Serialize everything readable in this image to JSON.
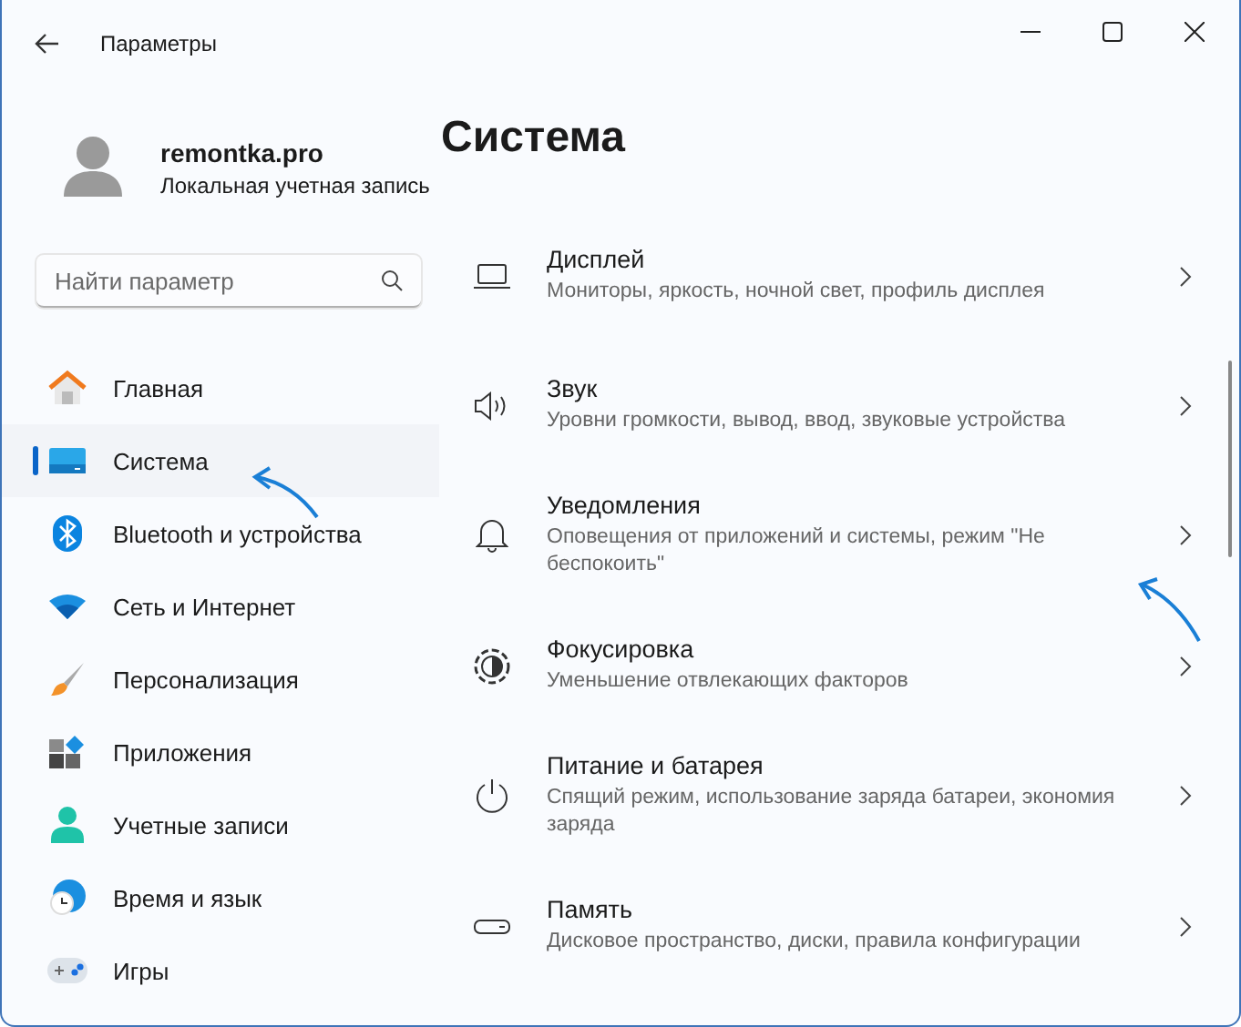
{
  "window": {
    "title": "Параметры"
  },
  "account": {
    "name": "remontka.pro",
    "type": "Локальная учетная запись"
  },
  "search": {
    "placeholder": "Найти параметр"
  },
  "sidebar": {
    "items": [
      {
        "label": "Главная",
        "selected": false
      },
      {
        "label": "Система",
        "selected": true
      },
      {
        "label": "Bluetooth и устройства",
        "selected": false
      },
      {
        "label": "Сеть и Интернет",
        "selected": false
      },
      {
        "label": "Персонализация",
        "selected": false
      },
      {
        "label": "Приложения",
        "selected": false
      },
      {
        "label": "Учетные записи",
        "selected": false
      },
      {
        "label": "Время и язык",
        "selected": false
      },
      {
        "label": "Игры",
        "selected": false
      }
    ]
  },
  "page": {
    "title": "Система",
    "items": [
      {
        "title": "Дисплей",
        "description": "Мониторы, яркость, ночной свет, профиль дисплея"
      },
      {
        "title": "Звук",
        "description": "Уровни громкости, вывод, ввод, звуковые устройства"
      },
      {
        "title": "Уведомления",
        "description": "Оповещения от приложений и системы, режим \"Не беспокоить\""
      },
      {
        "title": "Фокусировка",
        "description": "Уменьшение отвлекающих факторов"
      },
      {
        "title": "Питание и батарея",
        "description": "Спящий режим, использование заряда батареи, экономия заряда"
      },
      {
        "title": "Память",
        "description": "Дисковое пространство, диски, правила конфигурации"
      }
    ]
  }
}
